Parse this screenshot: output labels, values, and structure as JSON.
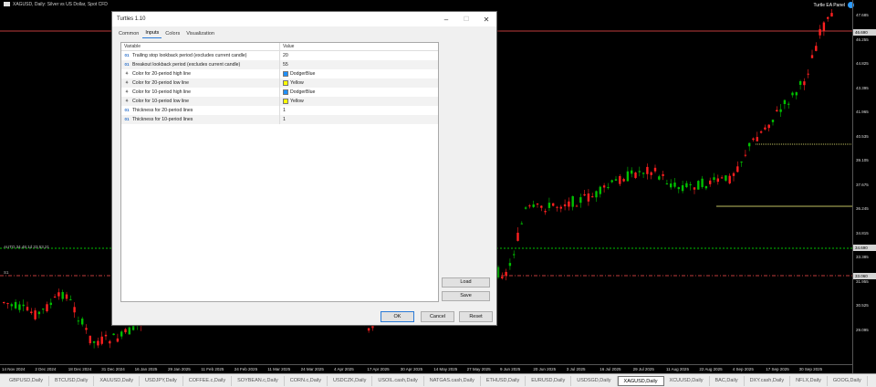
{
  "window": {
    "symbol_title": "XAGUSD, Daily: Silver vs US Dollar, Spot CFD",
    "ea_label": "Turtle EA Panel"
  },
  "chart_labels": {
    "left_top": "AUTO 34,48 1d 33,53,21",
    "left_bottom": "S1"
  },
  "price_axis": {
    "ticks": [
      "47.685",
      "46.255",
      "44.825",
      "43.395",
      "41.965",
      "40.535",
      "39.105",
      "37.675",
      "36.245",
      "34.815",
      "33.385",
      "31.955",
      "30.525",
      "29.095"
    ],
    "current_price": "46.690",
    "level_tag": "34.690",
    "lower_tag": "33.060"
  },
  "time_axis": {
    "ticks": [
      "14 Nov 2024",
      "2 Dec 2024",
      "18 Dec 2024",
      "31 Dec 2024",
      "16 Jan 2025",
      "29 Jan 2025",
      "11 Feb 2025",
      "24 Feb 2025",
      "11 Mar 2025",
      "24 Mar 2025",
      "4 Apr 2025",
      "17 Apr 2025",
      "30 Apr 2025",
      "14 May 2025",
      "27 May 2025",
      "9 Jun 2025",
      "20 Jun 2025",
      "3 Jul 2025",
      "16 Jul 2025",
      "29 Jul 2025",
      "11 Aug 2025",
      "22 Aug 2025",
      "4 Sep 2025",
      "17 Sep 2025",
      "30 Sep 2025"
    ]
  },
  "symbol_tabs": [
    {
      "label": "GBPUSD,Daily",
      "active": false
    },
    {
      "label": "BTCUSD,Daily",
      "active": false
    },
    {
      "label": "XAUUSD,Daily",
      "active": false
    },
    {
      "label": "USDJPY,Daily",
      "active": false
    },
    {
      "label": "COFFEE.c,Daily",
      "active": false
    },
    {
      "label": "SOYBEAN.c,Daily",
      "active": false
    },
    {
      "label": "CORN.c,Daily",
      "active": false
    },
    {
      "label": "USDCZK,Daily",
      "active": false
    },
    {
      "label": "USOIL.cash,Daily",
      "active": false
    },
    {
      "label": "NATGAS.cash,Daily",
      "active": false
    },
    {
      "label": "ETHUSD,Daily",
      "active": false
    },
    {
      "label": "EURUSD,Daily",
      "active": false
    },
    {
      "label": "USDSGD,Daily",
      "active": false
    },
    {
      "label": "XAGUSD,Daily",
      "active": true
    },
    {
      "label": "XCUUSD,Daily",
      "active": false
    },
    {
      "label": "BAC,Daily",
      "active": false
    },
    {
      "label": "DXY.cash,Daily",
      "active": false
    },
    {
      "label": "NFLX,Daily",
      "active": false
    },
    {
      "label": "GOOG,Daily",
      "active": false
    }
  ],
  "dialog": {
    "title": "Turtles 1.10",
    "tabs": [
      "Common",
      "Inputs",
      "Colors",
      "Visualization"
    ],
    "active_tab": "Inputs",
    "col_variable": "Variable",
    "col_value": "Value",
    "rows": [
      {
        "type": "num",
        "icon_text": "01",
        "variable": "Trailing stop lookback period (excludes current candle)",
        "value": "20",
        "color": ""
      },
      {
        "type": "num",
        "icon_text": "01",
        "variable": "Breakout lookback period (excludes current candle)",
        "value": "55",
        "color": ""
      },
      {
        "type": "color",
        "icon_text": "",
        "variable": "Color for 20-period high line",
        "value": "DodgerBlue",
        "color": "#1e90ff"
      },
      {
        "type": "color",
        "icon_text": "",
        "variable": "Color for 20-period low line",
        "value": "Yellow",
        "color": "#ffff00"
      },
      {
        "type": "color",
        "icon_text": "",
        "variable": "Color for 10-period high line",
        "value": "DodgerBlue",
        "color": "#1e90ff"
      },
      {
        "type": "color",
        "icon_text": "",
        "variable": "Color for 10-period low line",
        "value": "Yellow",
        "color": "#ffff00"
      },
      {
        "type": "num",
        "icon_text": "01",
        "variable": "Thickness for 20-period lines",
        "value": "1",
        "color": ""
      },
      {
        "type": "num",
        "icon_text": "01",
        "variable": "Thickness for 10-period lines",
        "value": "1",
        "color": ""
      }
    ],
    "load_label": "Load",
    "save_label": "Save",
    "ok_label": "OK",
    "cancel_label": "Cancel",
    "reset_label": "Reset"
  },
  "colors": {
    "bull": "#00c000",
    "bear": "#ff2020",
    "bid_line": "#ff5050",
    "trail_line": "#ffff80",
    "breakout_line": "#00ff00"
  }
}
